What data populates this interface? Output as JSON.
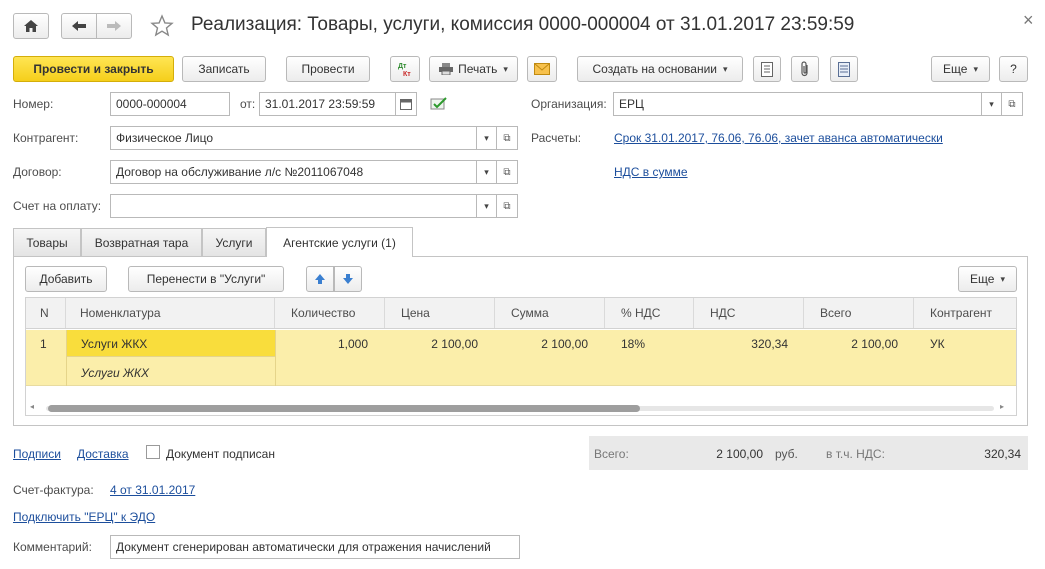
{
  "window": {
    "title": "Реализация: Товары, услуги, комиссия 0000-000004 от 31.01.2017 23:59:59",
    "close_glyph": "×"
  },
  "toolbar": {
    "post_close": "Провести и закрыть",
    "save": "Записать",
    "post": "Провести",
    "print": "Печать",
    "create_based": "Создать на основании",
    "more": "Еще",
    "help": "?"
  },
  "form": {
    "number_label": "Номер:",
    "number_value": "0000-000004",
    "date_label": "от:",
    "date_value": "31.01.2017 23:59:59",
    "org_label": "Организация:",
    "org_value": "ЕРЦ",
    "counterparty_label": "Контрагент:",
    "counterparty_value": "Физическое Лицо",
    "settlements_label": "Расчеты:",
    "settlements_link": "Срок 31.01.2017, 76.06, 76.06, зачет аванса автоматически",
    "contract_label": "Договор:",
    "contract_value": "Договор на обслуживание л/с №2011067048",
    "vat_link": "НДС в сумме",
    "invoice_label": "Счет на оплату:",
    "invoice_value": ""
  },
  "tabs": [
    {
      "label": "Товары"
    },
    {
      "label": "Возвратная тара"
    },
    {
      "label": "Услуги"
    },
    {
      "label": "Агентские услуги (1)"
    }
  ],
  "table_toolbar": {
    "add": "Добавить",
    "move": "Перенести в \"Услуги\"",
    "more": "Еще"
  },
  "table": {
    "columns": [
      "N",
      "Номенклатура",
      "Количество",
      "Цена",
      "Сумма",
      "% НДС",
      "НДС",
      "Всего",
      "Контрагент"
    ],
    "rows": [
      {
        "n": "1",
        "item": "Услуги ЖКХ",
        "item_sub": "Услуги ЖКХ",
        "qty": "1,000",
        "price": "2 100,00",
        "sum": "2 100,00",
        "vat_rate": "18%",
        "vat": "320,34",
        "total": "2 100,00",
        "counterparty": "УК"
      }
    ]
  },
  "footer": {
    "signatures_link": "Подписи",
    "delivery_link": "Доставка",
    "signed_label": "Документ подписан",
    "total_label": "Всего:",
    "total_value": "2 100,00",
    "currency": "руб.",
    "vat_incl_label": "в т.ч. НДС:",
    "vat_incl_value": "320,34",
    "invoice_fact_label": "Счет-фактура:",
    "invoice_fact_link": "4 от 31.01.2017",
    "edo_link": "Подключить \"ЕРЦ\" к ЭДО",
    "comment_label": "Комментарий:",
    "comment_value": "Документ сгенерирован автоматически для отражения  начислений"
  },
  "colors": {
    "accent_yellow": "#f5cf1b",
    "row_highlight": "#fbeeaa",
    "selected_cell": "#f9dd3c",
    "link": "#1c4e9c"
  }
}
